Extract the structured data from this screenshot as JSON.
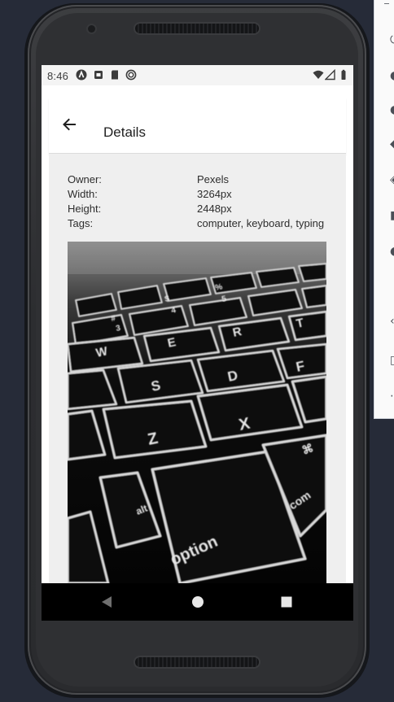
{
  "status_bar": {
    "time": "8:46",
    "notification_icons": [
      "a-icon",
      "sim-icon",
      "sd-card-icon",
      "sync-icon"
    ],
    "system_icons": [
      "wifi-icon",
      "signal-icon",
      "battery-icon"
    ]
  },
  "app_bar": {
    "back_icon": "arrow-left-icon",
    "title": "Details"
  },
  "details": {
    "rows": [
      {
        "label": "Owner:",
        "value": "Pexels"
      },
      {
        "label": "Width:",
        "value": "3264px"
      },
      {
        "label": "Height:",
        "value": "2448px"
      },
      {
        "label": "Tags:",
        "value": "computer, keyboard, typing"
      }
    ],
    "photo": {
      "subject": "keyboard photo",
      "key_labels": [
        "$",
        "4",
        "%",
        "5",
        "#",
        "3",
        "W",
        "E",
        "R",
        "T",
        "S",
        "D",
        "F",
        "Z",
        "X",
        "alt",
        "option",
        "command"
      ]
    }
  },
  "nav_bar": {
    "buttons": [
      "back-triangle-icon",
      "home-circle-icon",
      "recents-square-icon"
    ]
  },
  "colors": {
    "desktop_bg": "#262b38",
    "status_bar_bg": "#f4f4f4",
    "content_bg": "#efefef",
    "nav_bar_bg": "#000000",
    "text": "#2d2d2d"
  }
}
